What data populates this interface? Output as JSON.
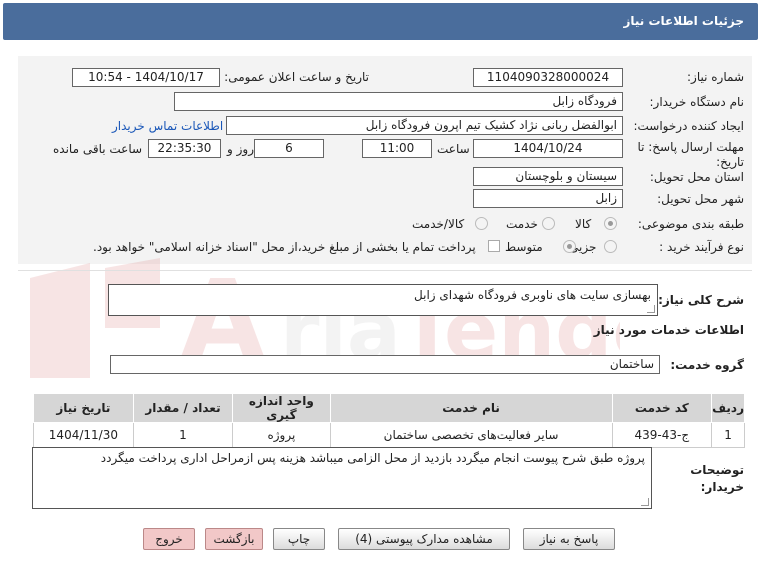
{
  "header": {
    "title": "جزئیات اطلاعات نیاز"
  },
  "fields": {
    "need_number_label": "شماره نیاز:",
    "need_number": "1104090328000024",
    "announce_label": "تاریخ و ساعت اعلان عمومی:",
    "announce_value": "1404/10/17 - 10:54",
    "buyer_label": "نام دستگاه خریدار:",
    "buyer_value": "فرودگاه زابل",
    "creator_label": "ایجاد کننده درخواست:",
    "creator_value": "ابوالفضل  ربانی نژاد کشیک تیم اپرون فرودگاه زابل",
    "contact_link": "اطلاعات تماس خریدار",
    "deadline_label": "مهلت ارسال پاسخ: تا تاریخ:",
    "deadline_date": "1404/10/24",
    "time_label": "ساعت",
    "deadline_time": "11:00",
    "days_value": "6",
    "days_label": "روز و",
    "remaining_value": "22:35:30",
    "remaining_label": "ساعت باقی مانده",
    "province_label": "استان محل تحویل:",
    "province_value": "سیستان و بلوچستان",
    "city_label": "شهر محل تحویل:",
    "city_value": "زابل",
    "category_label": "طبقه بندی موضوعی:",
    "category_options": [
      "کالا",
      "خدمت",
      "کالا/خدمت"
    ],
    "purchase_label": "نوع فرآیند خرید :",
    "purchase_options": [
      "جزیی",
      "متوسط"
    ],
    "payment_note": "پرداخت تمام یا بخشی از مبلغ خرید،از محل \"اسناد خزانه اسلامی\" خواهد بود."
  },
  "description": {
    "label": "شرح کلی نیاز:",
    "value": "بهسازی سایت های ناوبری فرودگاه شهدای زابل"
  },
  "services_info": {
    "title": "اطلاعات خدمات مورد نیاز",
    "group_label": "گروه خدمت:",
    "group_value": "ساختمان"
  },
  "table": {
    "headers": [
      "ردیف",
      "کد خدمت",
      "نام خدمت",
      "واحد اندازه گیری",
      "تعداد / مقدار",
      "تاریخ نیاز"
    ],
    "rows": [
      [
        "1",
        "ج-43-439",
        "سایر فعالیت‌های تخصصی ساختمان",
        "پروژه",
        "1",
        "1404/11/30"
      ]
    ]
  },
  "buyer_notes": {
    "label_line1": "توضیحات",
    "label_line2": "خریدار:",
    "value": "پروژه طبق شرح  پیوست انجام میگردد بازدید از محل الزامی میباشد هزینه پس ازمراحل اداری پرداخت میگردد"
  },
  "buttons": {
    "reply": "پاسخ به نیاز",
    "attachments": "مشاهده مدارک پیوستی (4)",
    "print": "چاپ",
    "back": "بازگشت",
    "exit": "خروج"
  }
}
